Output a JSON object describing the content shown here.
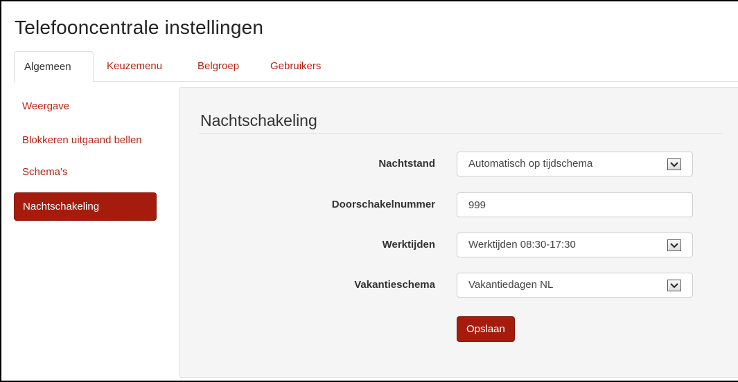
{
  "page": {
    "title": "Telefooncentrale instellingen"
  },
  "tabs": [
    {
      "label": "Algemeen",
      "active": true
    },
    {
      "label": "Keuzemenu",
      "active": false
    },
    {
      "label": "Belgroep",
      "active": false
    },
    {
      "label": "Gebruikers",
      "active": false
    }
  ],
  "sidebar": {
    "items": [
      {
        "label": "Weergave",
        "active": false
      },
      {
        "label": "Blokkeren uitgaand bellen",
        "active": false
      },
      {
        "label": "Schema's",
        "active": false
      },
      {
        "label": "Nachtschakeling",
        "active": true
      }
    ]
  },
  "section": {
    "title": "Nachtschakeling"
  },
  "form": {
    "nachtstand": {
      "label": "Nachtstand",
      "value": "Automatisch op tijdschema"
    },
    "doorschakelnummer": {
      "label": "Doorschakelnummer",
      "value": "999"
    },
    "werktijden": {
      "label": "Werktijden",
      "value": "Werktijden 08:30-17:30"
    },
    "vakantieschema": {
      "label": "Vakantieschema",
      "value": "Vakantiedagen NL"
    },
    "save_label": "Opslaan"
  },
  "icons": {
    "dropdown": "chevron-down-icon"
  },
  "colors": {
    "accent": "#a61c0c",
    "link": "#b52514",
    "panel_bg": "#f5f5f5"
  }
}
